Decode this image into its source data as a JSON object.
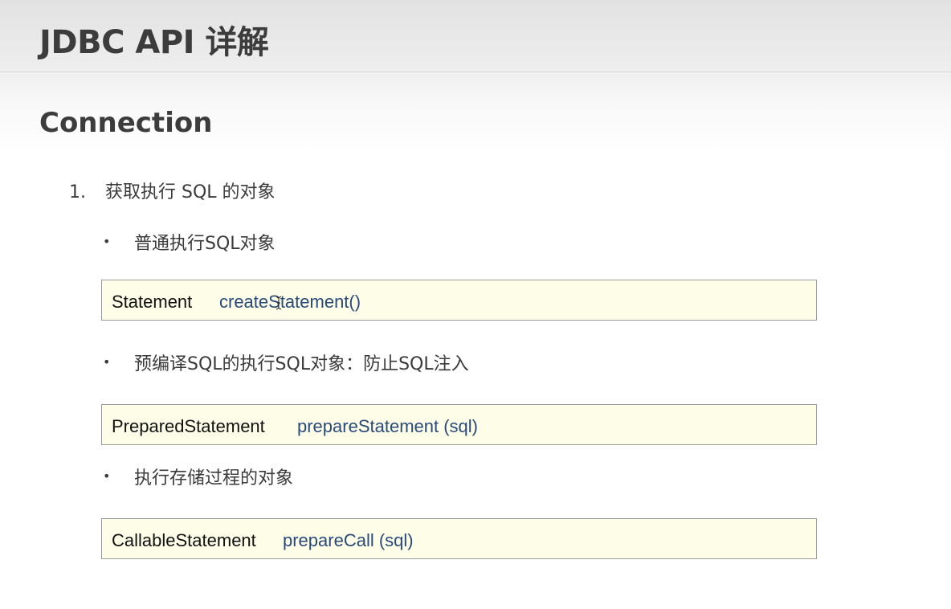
{
  "slide": {
    "title": "JDBC API 详解",
    "subtitle": "Connection",
    "numbered_item": {
      "number": "1.",
      "text": "获取执行 SQL 的对象"
    },
    "bullets": [
      {
        "marker": "•",
        "text": "普通执行SQL对象",
        "code": {
          "class_name": "Statement",
          "method": "createStatement()"
        }
      },
      {
        "marker": "•",
        "text": "预编译SQL的执行SQL对象：防止SQL注入",
        "code": {
          "class_name": "PreparedStatement",
          "method": "prepareStatement (sql)"
        }
      },
      {
        "marker": "•",
        "text": "执行存储过程的对象",
        "code": {
          "class_name": "CallableStatement",
          "method": "prepareCall (sql)"
        }
      }
    ]
  },
  "colors": {
    "code_background": "#fdfde8",
    "code_border": "#9a9a9a",
    "method_text": "#2a4a7a",
    "heading_text": "#3c3c3c"
  },
  "icons": {
    "cursor": "text-cursor-icon"
  }
}
